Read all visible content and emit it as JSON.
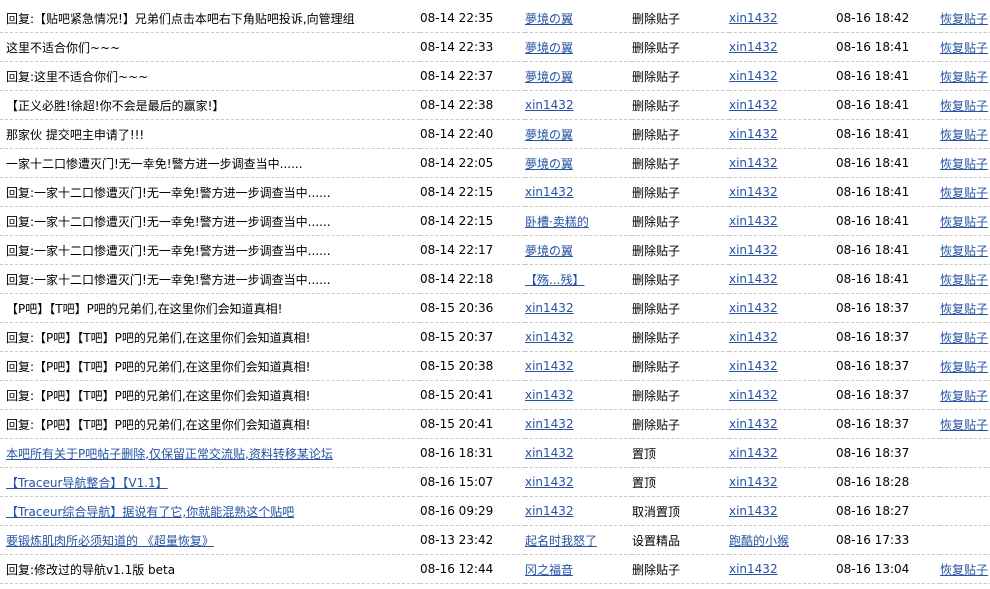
{
  "rows": [
    {
      "title": "回复:【贴吧紧急情况!】兄弟们点击本吧右下角贴吧投诉,向管理组",
      "title_is_link": false,
      "time": "08-14 22:35",
      "user": "夢境の翼",
      "action": "删除贴子",
      "operator": "xin1432",
      "op_time": "08-16 18:42",
      "recover": "恢复贴子"
    },
    {
      "title": "这里不适合你们~~~",
      "title_is_link": false,
      "time": "08-14 22:33",
      "user": "夢境の翼",
      "action": "删除贴子",
      "operator": "xin1432",
      "op_time": "08-16 18:41",
      "recover": "恢复贴子"
    },
    {
      "title": "回复:这里不适合你们~~~",
      "title_is_link": false,
      "time": "08-14 22:37",
      "user": "夢境の翼",
      "action": "删除贴子",
      "operator": "xin1432",
      "op_time": "08-16 18:41",
      "recover": "恢复贴子"
    },
    {
      "title": "【正义必胜!徐超!你不会是最后的赢家!】",
      "title_is_link": false,
      "time": "08-14 22:38",
      "user": "xin1432",
      "action": "删除贴子",
      "operator": "xin1432",
      "op_time": "08-16 18:41",
      "recover": "恢复贴子"
    },
    {
      "title": "那家伙 提交吧主申请了!!!",
      "title_is_link": false,
      "time": "08-14 22:40",
      "user": "夢境の翼",
      "action": "删除贴子",
      "operator": "xin1432",
      "op_time": "08-16 18:41",
      "recover": "恢复贴子"
    },
    {
      "title": "一家十二口惨遭灭门!无一幸免!警方进一步调查当中......",
      "title_is_link": false,
      "time": "08-14 22:05",
      "user": "夢境の翼",
      "action": "删除贴子",
      "operator": "xin1432",
      "op_time": "08-16 18:41",
      "recover": "恢复贴子"
    },
    {
      "title": "回复:一家十二口惨遭灭门!无一幸免!警方进一步调查当中......",
      "title_is_link": false,
      "time": "08-14 22:15",
      "user": "xin1432",
      "action": "删除贴子",
      "operator": "xin1432",
      "op_time": "08-16 18:41",
      "recover": "恢复贴子"
    },
    {
      "title": "回复:一家十二口惨遭灭门!无一幸免!警方进一步调查当中......",
      "title_is_link": false,
      "time": "08-14 22:15",
      "user": "卧槽·卖糕的",
      "action": "删除贴子",
      "operator": "xin1432",
      "op_time": "08-16 18:41",
      "recover": "恢复贴子"
    },
    {
      "title": "回复:一家十二口惨遭灭门!无一幸免!警方进一步调查当中......",
      "title_is_link": false,
      "time": "08-14 22:17",
      "user": "夢境の翼",
      "action": "删除贴子",
      "operator": "xin1432",
      "op_time": "08-16 18:41",
      "recover": "恢复贴子"
    },
    {
      "title": "回复:一家十二口惨遭灭门!无一幸免!警方进一步调查当中......",
      "title_is_link": false,
      "time": "08-14 22:18",
      "user": "【殇...残】",
      "action": "删除贴子",
      "operator": "xin1432",
      "op_time": "08-16 18:41",
      "recover": "恢复贴子"
    },
    {
      "title": "【P吧】【T吧】P吧的兄弟们,在这里你们会知道真相!",
      "title_is_link": false,
      "time": "08-15 20:36",
      "user": "xin1432",
      "action": "删除贴子",
      "operator": "xin1432",
      "op_time": "08-16 18:37",
      "recover": "恢复贴子"
    },
    {
      "title": "回复:【P吧】【T吧】P吧的兄弟们,在这里你们会知道真相!",
      "title_is_link": false,
      "time": "08-15 20:37",
      "user": "xin1432",
      "action": "删除贴子",
      "operator": "xin1432",
      "op_time": "08-16 18:37",
      "recover": "恢复贴子"
    },
    {
      "title": "回复:【P吧】【T吧】P吧的兄弟们,在这里你们会知道真相!",
      "title_is_link": false,
      "time": "08-15 20:38",
      "user": "xin1432",
      "action": "删除贴子",
      "operator": "xin1432",
      "op_time": "08-16 18:37",
      "recover": "恢复贴子"
    },
    {
      "title": "回复:【P吧】【T吧】P吧的兄弟们,在这里你们会知道真相!",
      "title_is_link": false,
      "time": "08-15 20:41",
      "user": "xin1432",
      "action": "删除贴子",
      "operator": "xin1432",
      "op_time": "08-16 18:37",
      "recover": "恢复贴子"
    },
    {
      "title": "回复:【P吧】【T吧】P吧的兄弟们,在这里你们会知道真相!",
      "title_is_link": false,
      "time": "08-15 20:41",
      "user": "xin1432",
      "action": "删除贴子",
      "operator": "xin1432",
      "op_time": "08-16 18:37",
      "recover": "恢复贴子"
    },
    {
      "title": "本吧所有关于P吧帖子删除,仅保留正常交流贴,资料转移某论坛",
      "title_is_link": true,
      "time": "08-16 18:31",
      "user": "xin1432",
      "action": "置顶",
      "operator": "xin1432",
      "op_time": "08-16 18:37",
      "recover": ""
    },
    {
      "title": "【Traceur导航整合】【V1.1】",
      "title_is_link": true,
      "time": "08-16 15:07",
      "user": "xin1432",
      "action": "置顶",
      "operator": "xin1432",
      "op_time": "08-16 18:28",
      "recover": ""
    },
    {
      "title": "【Traceur综合导航】据说有了它,你就能混熟这个贴吧",
      "title_is_link": true,
      "time": "08-16 09:29",
      "user": "xin1432",
      "action": "取消置顶",
      "operator": "xin1432",
      "op_time": "08-16 18:27",
      "recover": ""
    },
    {
      "title": "要锻炼肌肉所必须知道的 《超量恢复》",
      "title_is_link": true,
      "time": "08-13 23:42",
      "user": "起名时我怒了",
      "action": "设置精品",
      "operator": "跑酷的小猴",
      "op_time": "08-16 17:33",
      "recover": ""
    },
    {
      "title": "回复:修改过的导航v1.1版 beta",
      "title_is_link": false,
      "time": "08-16 12:44",
      "user": "冈之福音",
      "action": "删除贴子",
      "operator": "xin1432",
      "op_time": "08-16 13:04",
      "recover": "恢复贴子"
    }
  ]
}
